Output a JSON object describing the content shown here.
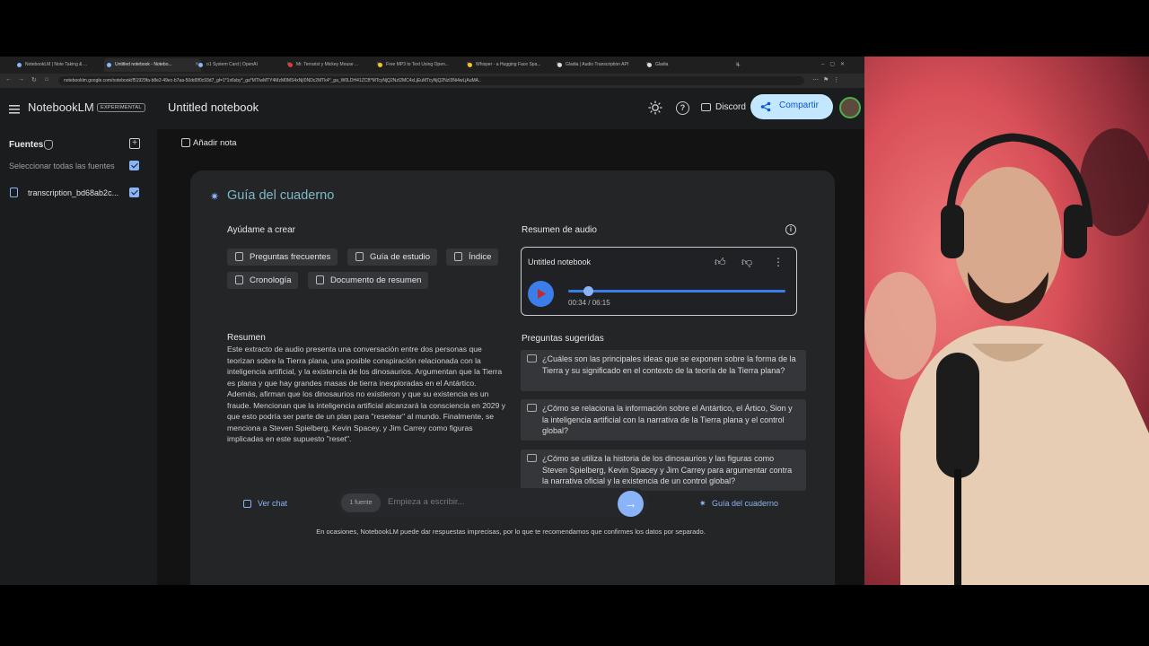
{
  "browser": {
    "tabs": [
      {
        "label": "NotebookLM | Note Taking & ...",
        "active": false
      },
      {
        "label": "Untitled notebook - Notebo...",
        "active": true
      },
      {
        "label": "o1 System Card | OpenAI",
        "active": false
      },
      {
        "label": "Mr. Terrarist y Mickey Mouse ...",
        "active": false
      },
      {
        "label": "Free MP3 to Text Using Open...",
        "active": false
      },
      {
        "label": "Whisper - a Hugging Face Spa...",
        "active": false
      },
      {
        "label": "Gladia | Audio Transcription API",
        "active": false
      },
      {
        "label": "Gladia",
        "active": false
      }
    ],
    "url": "notebooklm.google.com/notebook/f51929fa-b8e2-49ec-b7aa-50dd0f0c93d7_gl=1*1x6sby*_ga*MTIwMTY4MzM0MS4xNjI0NDc2MTk4*_ga_W0LDH41ZCB*MTcyNjQ2NzI2MC4xLjEuMTcyNjQ2NzI3Ni4wLjAuMA.."
  },
  "header": {
    "app_name": "NotebookLM",
    "badge": "EXPERIMENTAL",
    "notebook_title": "Untitled notebook",
    "discord": "Discord",
    "share": "Compartir"
  },
  "sidebar": {
    "title": "Fuentes",
    "select_all": "Seleccionar todas las fuentes",
    "sources": [
      {
        "label": "transcription_bd68ab2c..."
      }
    ]
  },
  "main": {
    "add_note": "Añadir nota",
    "guide_title": "Guía del cuaderno",
    "help_create": "Ayúdame a crear",
    "chips": [
      "Preguntas frecuentes",
      "Guía de estudio",
      "Índice",
      "Cronología",
      "Documento de resumen"
    ],
    "summary_title": "Resumen",
    "summary_text": "Este extracto de audio presenta una conversación entre dos personas que teorizan sobre la Tierra plana, una posible conspiración relacionada con la inteligencia artificial, y la existencia de los dinosaurios. Argumentan que la Tierra es plana y que hay grandes masas de tierra inexploradas en el Antártico. Además, afirman que los dinosaurios no existieron y que su existencia es un fraude. Mencionan que la inteligencia artificial alcanzará la consciencia en 2029 y que esto podría ser parte de un plan para \"resetear\" al mundo. Finalmente, se menciona a Steven Spielberg, Kevin Spacey, y Jim Carrey como figuras implicadas en este supuesto \"reset\".",
    "audio_title": "Resumen de audio",
    "player": {
      "title": "Untitled notebook",
      "time": "00:34 / 06:15",
      "progress": 0.09
    },
    "suggested_title": "Preguntas sugeridas",
    "questions": [
      "¿Cuáles son las principales ideas que se exponen sobre la forma de la Tierra y su significado en el contexto de la teoría de la Tierra plana?",
      "¿Cómo se relaciona la información sobre el Antártico, el Ártico, Sion y la inteligencia artificial con la narrativa de la Tierra plana y el control global?",
      "¿Cómo se utiliza la historia de los dinosaurios y las figuras como Steven Spielberg, Kevin Spacey y Jim Carrey para argumentar contra la narrativa oficial y la existencia de un control global?"
    ],
    "footer": {
      "view_chat": "Ver chat",
      "source_count": "1 fuente",
      "input_placeholder": "Empieza a escribir...",
      "guide_link": "Guía del cuaderno",
      "disclaimer": "En ocasiones, NotebookLM puede dar respuestas imprecisas, por lo que te recomendamos que confirmes los datos por separado."
    }
  },
  "colors": {
    "accent": "#8ab4f8",
    "play": "#3b7de9",
    "share_bg": "#c2e7ff"
  }
}
